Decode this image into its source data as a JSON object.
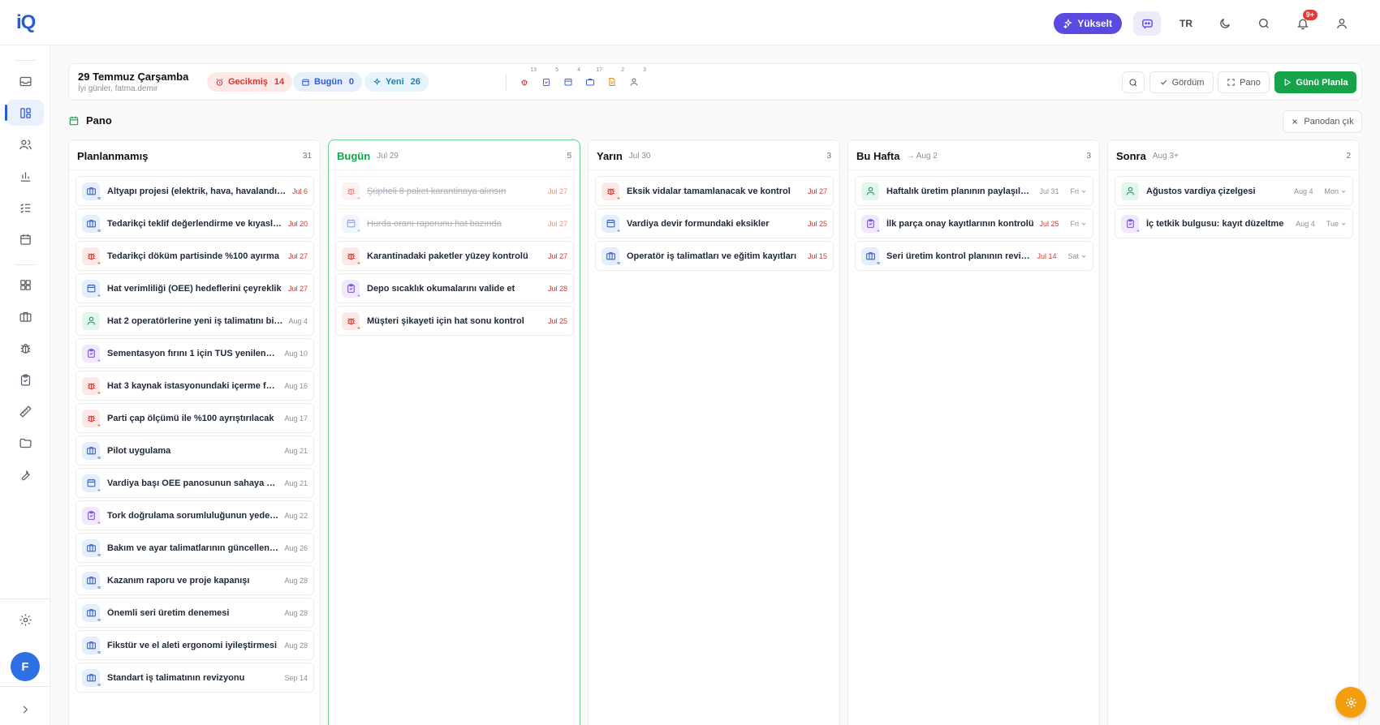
{
  "brand": {
    "logo": "iQ"
  },
  "topbar": {
    "upgrade_label": "Yükselt",
    "lang": "TR",
    "notif_badge": "9+"
  },
  "header": {
    "date": "29 Temmuz Çarşamba",
    "greeting": "İyi günler, fatma.demir",
    "chips": [
      {
        "label": "Gecikmiş",
        "count": "14"
      },
      {
        "label": "Bugün",
        "count": "0"
      },
      {
        "label": "Yeni",
        "count": "26"
      }
    ],
    "type_counts": [
      "13",
      "5",
      "4",
      "17",
      "2",
      "3"
    ],
    "buttons": {
      "seen": "Gördüm",
      "board": "Pano",
      "plan": "Günü Planla"
    }
  },
  "board": {
    "title": "Pano",
    "exit_label": "Panodan çık"
  },
  "columns": [
    {
      "title": "Planlanmamış",
      "date": "",
      "count": "31",
      "cards": [
        {
          "icon": "briefcase",
          "title": "Altyapı projesi (elektrik, hava, havalandırma)",
          "date": "Jul 6",
          "late": true
        },
        {
          "icon": "briefcase",
          "title": "Tedarikçi teklif değerlendirme ve kıyaslama",
          "date": "Jul 20",
          "late": true
        },
        {
          "icon": "bug",
          "title": "Tedarikçi döküm partisinde %100 ayırma",
          "date": "Jul 27",
          "late": true
        },
        {
          "icon": "calendar",
          "title": "Hat verimliliği (OEE) hedeflerini çeyreklik",
          "date": "Jul 27",
          "late": true
        },
        {
          "icon": "user",
          "title": "Hat 2 operatörlerine yeni iş talimatını bildir",
          "date": "Aug 4",
          "late": false
        },
        {
          "icon": "clipboard",
          "title": "Sementasyon fırını 1 için TUS yenilenmesi",
          "date": "Aug 10",
          "late": false
        },
        {
          "icon": "bug",
          "title": "Hat 3 kaynak istasyonundaki içerme faaliyeti",
          "date": "Aug 16",
          "late": false
        },
        {
          "icon": "bug",
          "title": "Parti çap ölçümü ile %100 ayrıştırılacak",
          "date": "Aug 17",
          "late": false
        },
        {
          "icon": "briefcase",
          "title": "Pilot uygulama",
          "date": "Aug 21",
          "late": false
        },
        {
          "icon": "calendar",
          "title": "Vardiya başı OEE panosunun sahaya konulması",
          "date": "Aug 21",
          "late": false
        },
        {
          "icon": "clipboard",
          "title": "Tork doğrulama sorumluluğunun yedeklenmesi",
          "date": "Aug 22",
          "late": false
        },
        {
          "icon": "briefcase",
          "title": "Bakım ve ayar talimatlarının güncellenmesi",
          "date": "Aug 26",
          "late": false
        },
        {
          "icon": "briefcase",
          "title": "Kazanım raporu ve proje kapanışı",
          "date": "Aug 28",
          "late": false
        },
        {
          "icon": "briefcase",
          "title": "Önemli seri üretim denemesi",
          "date": "Aug 28",
          "late": false
        },
        {
          "icon": "briefcase",
          "title": "Fikstür ve el aleti ergonomi iyileştirmesi",
          "date": "Aug 28",
          "late": false
        },
        {
          "icon": "briefcase",
          "title": "Standart iş talimatının revizyonu",
          "date": "Sep 14",
          "late": false
        }
      ]
    },
    {
      "title": "Bugün",
      "date": "Jul 29",
      "count": "5",
      "cards": [
        {
          "icon": "bug",
          "title": "Şüpheli 8 paket karantinaya alınsın",
          "date": "Jul 27",
          "late": true,
          "done": true
        },
        {
          "icon": "calendar",
          "title": "Hurda oranı raporunu hat bazında",
          "date": "Jul 27",
          "late": true,
          "done": true
        },
        {
          "icon": "bug",
          "title": "Karantinadaki paketler yüzey kontrolü",
          "date": "Jul 27",
          "late": true
        },
        {
          "icon": "clipboard",
          "title": "Depo sıcaklık okumalarını valide et",
          "date": "Jul 28",
          "late": true
        },
        {
          "icon": "bug",
          "title": "Müşteri şikayeti için hat sonu kontrol",
          "date": "Jul 25",
          "late": true
        }
      ]
    },
    {
      "title": "Yarın",
      "date": "Jul 30",
      "count": "3",
      "cards": [
        {
          "icon": "bug",
          "title": "Eksik vidalar tamamlanacak ve kontrol",
          "date": "Jul 27",
          "late": true
        },
        {
          "icon": "calendar",
          "title": "Vardiya devir formundaki eksikler",
          "date": "Jul 25",
          "late": true
        },
        {
          "icon": "briefcase",
          "title": "Operatör iş talimatları ve eğitim kayıtları",
          "date": "Jul 15",
          "late": true
        }
      ]
    },
    {
      "title": "Bu Hafta",
      "date": "→ Aug 2",
      "count": "3",
      "cards": [
        {
          "icon": "user",
          "title": "Haftalık üretim planının paylaşılması",
          "date": "Jul 31",
          "late": false,
          "day": "Fri"
        },
        {
          "icon": "clipboard",
          "title": "İlk parça onay kayıtlarının kontrolü",
          "date": "Jul 25",
          "late": true,
          "day": "Fri"
        },
        {
          "icon": "briefcase",
          "title": "Seri üretim kontrol planının revizyonu",
          "date": "Jul 14",
          "late": true,
          "day": "Sat"
        }
      ]
    },
    {
      "title": "Sonra",
      "date": "Aug 3+",
      "count": "2",
      "cards": [
        {
          "icon": "user",
          "title": "Ağustos vardiya çizelgesi",
          "date": "Aug 4",
          "late": false,
          "day": "Mon"
        },
        {
          "icon": "clipboard",
          "title": "İç tetkik bulgusu: kayıt düzeltme",
          "date": "Aug 4",
          "late": false,
          "day": "Tue"
        }
      ]
    }
  ]
}
